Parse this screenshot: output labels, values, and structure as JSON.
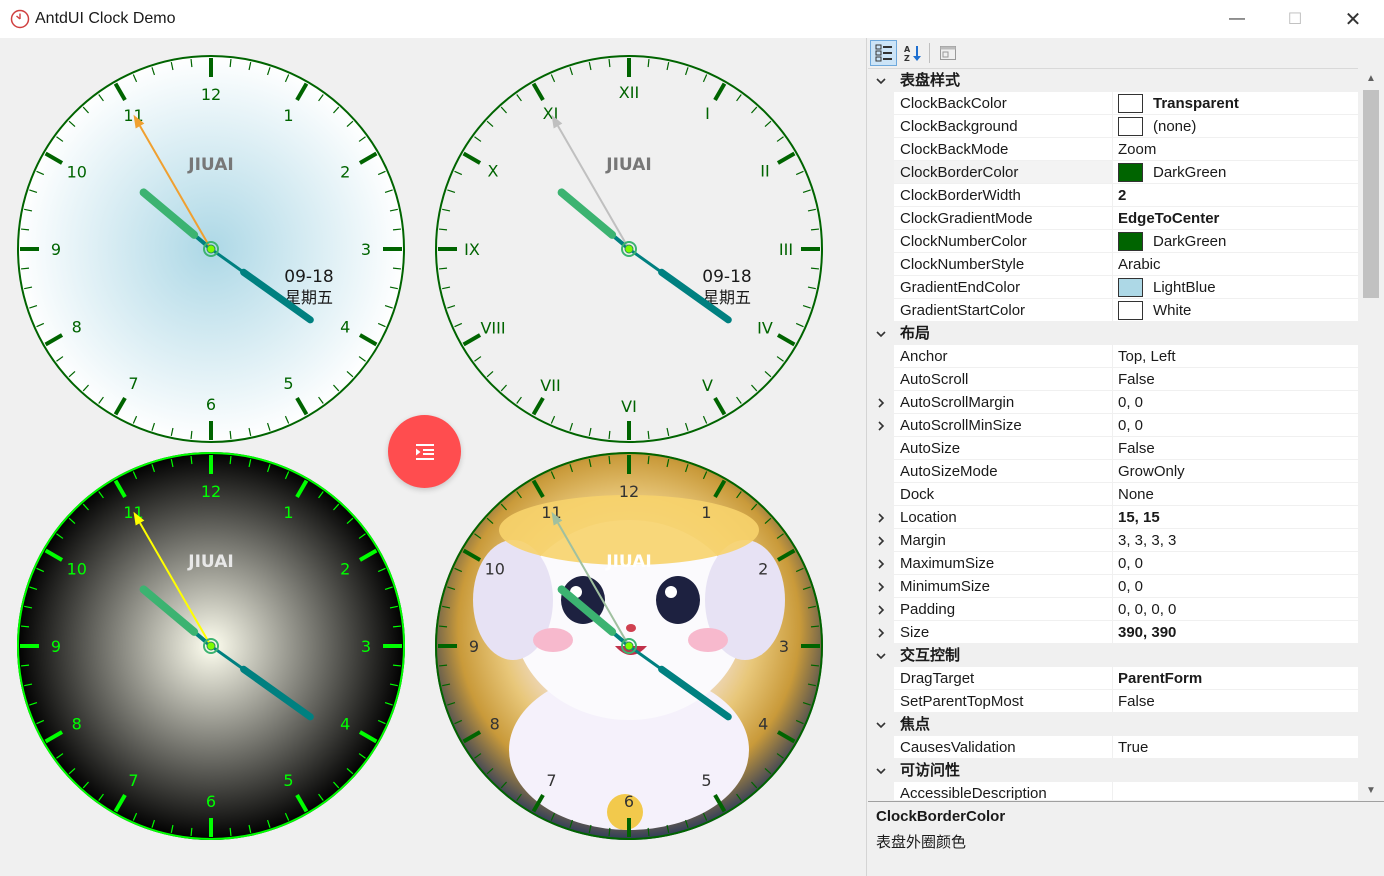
{
  "window": {
    "title": "AntdUI Clock Demo",
    "minimize_glyph": "—",
    "maximize_glyph": "☐",
    "close_glyph": "✕"
  },
  "clocks": [
    {
      "id": "clock-arabic-lightblue",
      "brand": "JIUAI",
      "date": "09-18",
      "weekday": "星期五",
      "numbers": [
        "12",
        "1",
        "2",
        "3",
        "4",
        "5",
        "6",
        "7",
        "8",
        "9",
        "10",
        "11"
      ],
      "colors": {
        "border": "#006400",
        "numbers": "#006400",
        "gradient_start": "#ffffff",
        "gradient_end": "#add8e6",
        "second_hand": "#f0a030",
        "hour_hand": "#3cb371",
        "minute_hand": "#008080"
      }
    },
    {
      "id": "clock-roman-transparent",
      "brand": "JIUAI",
      "date": "09-18",
      "weekday": "星期五",
      "numbers": [
        "XII",
        "I",
        "II",
        "III",
        "IV",
        "V",
        "VI",
        "VII",
        "VIII",
        "IX",
        "X",
        "XI"
      ],
      "colors": {
        "border": "#006400",
        "numbers": "#006400",
        "second_hand": "#c0c0c0",
        "hour_hand": "#3cb371",
        "minute_hand": "#008080"
      }
    },
    {
      "id": "clock-dark-glow",
      "brand": "JIUAI",
      "numbers": [
        "12",
        "1",
        "2",
        "3",
        "4",
        "5",
        "6",
        "7",
        "8",
        "9",
        "10",
        "11"
      ],
      "colors": {
        "border": "#00ff00",
        "numbers": "#00ff00",
        "gradient_start": "#fffff0",
        "gradient_end": "#000000",
        "second_hand": "#ffff00",
        "hour_hand": "#3cb371",
        "minute_hand": "#008080"
      }
    },
    {
      "id": "clock-image-background",
      "brand": "JIUAI",
      "numbers": [
        "12",
        "1",
        "2",
        "3",
        "4",
        "5",
        "6",
        "7",
        "8",
        "9",
        "10",
        "11"
      ],
      "colors": {
        "border": "#006400",
        "numbers": "#333333",
        "second_hand": "#a0c0a0",
        "hour_hand": "#3cb371",
        "minute_hand": "#008080"
      }
    }
  ],
  "time": {
    "hour": 10,
    "minute": 20,
    "second": 55
  },
  "fab": {
    "icon": "indent-icon",
    "color": "#ff4d4f"
  },
  "property_grid": {
    "toolbar": [
      {
        "name": "categorized-view-icon",
        "active": true
      },
      {
        "name": "alphabetical-sort-icon",
        "active": false
      },
      {
        "name": "property-pages-icon",
        "active": false
      }
    ],
    "rows": [
      {
        "kind": "category",
        "label": "表盘样式"
      },
      {
        "kind": "prop",
        "name": "ClockBackColor",
        "value": "Transparent",
        "bold": true,
        "swatch": "#ffffff"
      },
      {
        "kind": "prop",
        "name": "ClockBackground",
        "value": "(none)",
        "swatch": "#ffffff"
      },
      {
        "kind": "prop",
        "name": "ClockBackMode",
        "value": "Zoom"
      },
      {
        "kind": "prop",
        "name": "ClockBorderColor",
        "value": "DarkGreen",
        "swatch": "#006400",
        "selected": true
      },
      {
        "kind": "prop",
        "name": "ClockBorderWidth",
        "value": "2",
        "bold": true
      },
      {
        "kind": "prop",
        "name": "ClockGradientMode",
        "value": "EdgeToCenter",
        "bold": true
      },
      {
        "kind": "prop",
        "name": "ClockNumberColor",
        "value": "DarkGreen",
        "swatch": "#006400"
      },
      {
        "kind": "prop",
        "name": "ClockNumberStyle",
        "value": "Arabic"
      },
      {
        "kind": "prop",
        "name": "GradientEndColor",
        "value": "LightBlue",
        "swatch": "#add8e6"
      },
      {
        "kind": "prop",
        "name": "GradientStartColor",
        "value": "White",
        "swatch": "#ffffff"
      },
      {
        "kind": "category",
        "label": "布局"
      },
      {
        "kind": "prop",
        "name": "Anchor",
        "value": "Top, Left"
      },
      {
        "kind": "prop",
        "name": "AutoScroll",
        "value": "False"
      },
      {
        "kind": "prop",
        "name": "AutoScrollMargin",
        "value": "0, 0",
        "expandable": true
      },
      {
        "kind": "prop",
        "name": "AutoScrollMinSize",
        "value": "0, 0",
        "expandable": true
      },
      {
        "kind": "prop",
        "name": "AutoSize",
        "value": "False"
      },
      {
        "kind": "prop",
        "name": "AutoSizeMode",
        "value": "GrowOnly"
      },
      {
        "kind": "prop",
        "name": "Dock",
        "value": "None"
      },
      {
        "kind": "prop",
        "name": "Location",
        "value": "15, 15",
        "bold": true,
        "expandable": true
      },
      {
        "kind": "prop",
        "name": "Margin",
        "value": "3, 3, 3, 3",
        "expandable": true
      },
      {
        "kind": "prop",
        "name": "MaximumSize",
        "value": "0, 0",
        "expandable": true
      },
      {
        "kind": "prop",
        "name": "MinimumSize",
        "value": "0, 0",
        "expandable": true
      },
      {
        "kind": "prop",
        "name": "Padding",
        "value": "0, 0, 0, 0",
        "expandable": true
      },
      {
        "kind": "prop",
        "name": "Size",
        "value": "390, 390",
        "bold": true,
        "expandable": true
      },
      {
        "kind": "category",
        "label": "交互控制"
      },
      {
        "kind": "prop",
        "name": "DragTarget",
        "value": "ParentForm",
        "bold": true
      },
      {
        "kind": "prop",
        "name": "SetParentTopMost",
        "value": "False"
      },
      {
        "kind": "category",
        "label": "焦点"
      },
      {
        "kind": "prop",
        "name": "CausesValidation",
        "value": "True"
      },
      {
        "kind": "category",
        "label": "可访问性"
      },
      {
        "kind": "prop",
        "name": "AccessibleDescription",
        "value": ""
      }
    ],
    "help": {
      "title": "ClockBorderColor",
      "description": "表盘外圈颜色"
    }
  }
}
